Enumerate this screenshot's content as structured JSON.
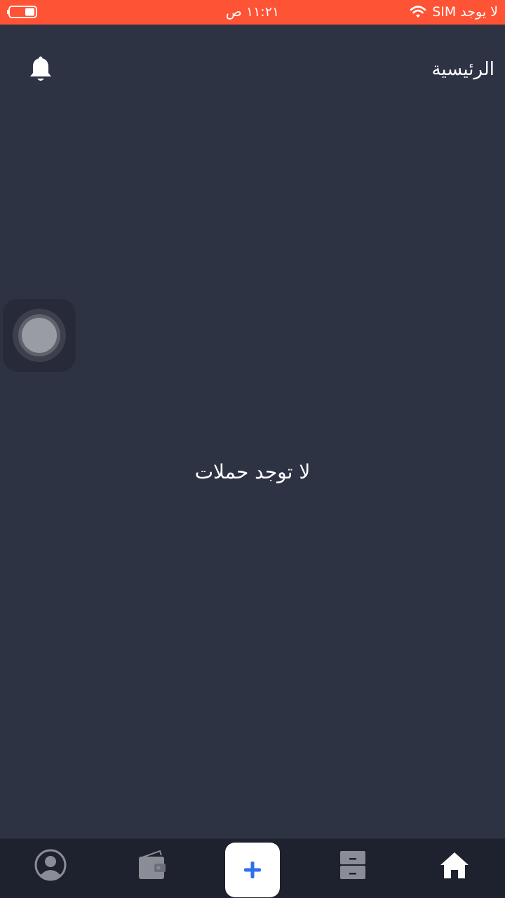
{
  "status_bar": {
    "carrier": "لا يوجد SIM",
    "time": "١١:٢١ ص",
    "wifi_icon": "wifi-icon",
    "battery_icon": "battery-icon",
    "background": "#fe5335"
  },
  "header": {
    "title": "الرئيسية",
    "notifications_icon": "bell-icon"
  },
  "main": {
    "empty_message": "لا توجد حملات"
  },
  "tab_bar": {
    "items": [
      {
        "icon": "profile-icon",
        "active": false
      },
      {
        "icon": "wallet-icon",
        "active": false
      },
      {
        "icon": "plus-icon",
        "active": false
      },
      {
        "icon": "archive-icon",
        "active": false
      },
      {
        "icon": "home-icon",
        "active": true
      }
    ],
    "accent": "#2f6ff0"
  }
}
